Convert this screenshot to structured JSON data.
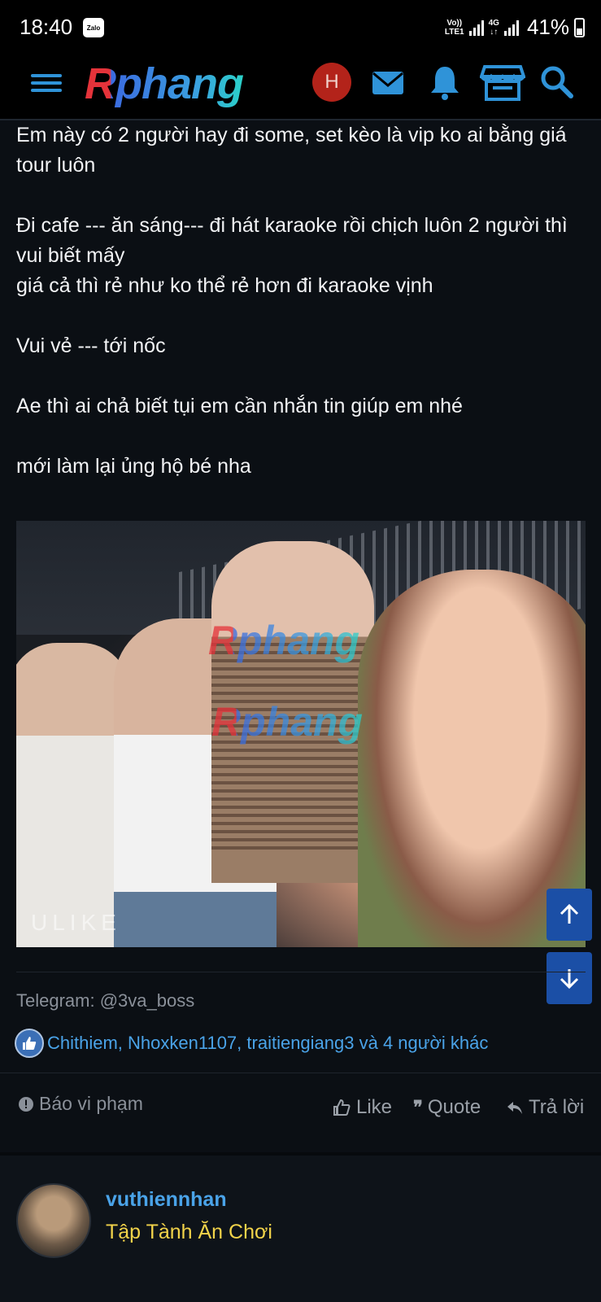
{
  "status_bar": {
    "time": "18:40",
    "zalo_label": "Zalo",
    "network_top": "Vo))",
    "network_bottom": "LTE1",
    "network_4g": "4G",
    "battery": "41%"
  },
  "header": {
    "logo": "Rphang",
    "avatar_letter": "H",
    "icons": [
      "menu-icon",
      "mail-icon",
      "bell-icon",
      "store-icon",
      "search-icon"
    ],
    "accent_color": "#2f93d8"
  },
  "post": {
    "lines": [
      "Em này có 2 người hay đi some, set kèo là vip ko ai bằng giá tour luôn",
      "",
      "Đi cafe --- ăn sáng--- đi hát karaoke rồi chịch luôn 2 người thì vui biết mấy",
      "giá cả thì rẻ như ko thể rẻ hơn đi karaoke vịnh",
      "",
      "Vui vẻ --- tới nốc",
      "",
      "Ae thì ai chả biết tụi em cần nhắn tin giúp em nhé",
      "",
      "mới làm lại ủng hộ bé nha"
    ],
    "image": {
      "watermark": "Rphang",
      "camera_mark": "ULIKE"
    },
    "signature": "Telegram: @3va_boss",
    "reactions": "Chithiem, Nhoxken1107, traitiengiang3 và 4 người khác"
  },
  "actions": {
    "report": "Báo vi phạm",
    "like": "Like",
    "quote": "Quote",
    "reply": "Trả lời"
  },
  "next_post": {
    "username": "vuthiennhan",
    "user_title": "Tập Tành Ăn Chơi"
  }
}
